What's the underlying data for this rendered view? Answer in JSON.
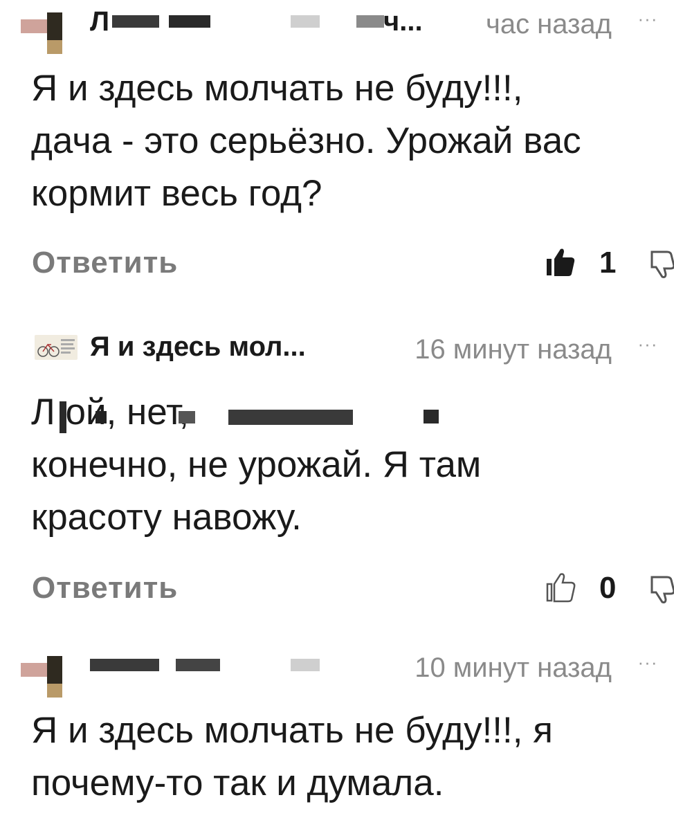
{
  "comments": [
    {
      "author": "Л",
      "author_tail": "ч...",
      "time": "час назад",
      "lines": [
        "Я и здесь молчать не буду!!!,",
        "дача - это серьёзно. Урожай вас",
        "кормит весь год?"
      ],
      "reply_label": "Ответить",
      "likes": "1",
      "liked": true
    },
    {
      "author": "Я и здесь мол...",
      "time": "16 минут назад",
      "lines": [
        "Л                                  ой, нет,",
        "конечно, не урожай. Я там",
        "красоту навожу."
      ],
      "reply_label": "Ответить",
      "likes": "0",
      "liked": false
    },
    {
      "author": "",
      "time": "10 минут назад",
      "lines": [
        "Я и здесь молчать не буду!!!, я",
        "почему-то так и думала."
      ]
    }
  ],
  "more_symbol": "···",
  "colors": {
    "text": "#1a1a1a",
    "muted": "#8a8a8a",
    "reply": "#7a7a7a",
    "avatar_tan": "#b99a68",
    "avatar_pink": "#cfa39b"
  },
  "icons": {
    "like_filled": "thumbs-up-filled-icon",
    "like_outline": "thumbs-up-outline-icon",
    "dislike": "thumbs-down-icon",
    "more": "more-dots-icon"
  }
}
